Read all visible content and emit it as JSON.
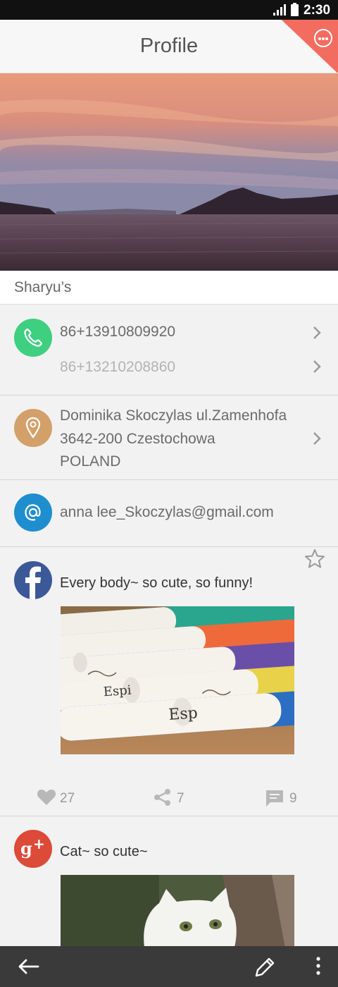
{
  "status_bar": {
    "time": "2:30"
  },
  "header": {
    "title": "Profile"
  },
  "profile": {
    "name": "Sharyu’s"
  },
  "phones": [
    "86+13910809920",
    "86+13210208860"
  ],
  "address": {
    "line1": "Dominika Skoczylas ul.Zamenhofa",
    "line2": "3642-200 Czestochowa",
    "line3": "POLAND"
  },
  "email": "anna lee_Skoczylas@gmail.com",
  "posts": [
    {
      "network": "facebook",
      "text": "Every body~ so cute, so funny!",
      "likes": "27",
      "shares": "7",
      "comments": "9"
    },
    {
      "network": "google-plus",
      "text": "Cat~ so cute~"
    }
  ],
  "colors": {
    "accent_corner": "#f36c60",
    "phone_icon": "#3ecf80",
    "location_icon": "#d3a06a",
    "email_icon": "#1e8ecf",
    "facebook": "#3b5998",
    "google_plus": "#dc4a38",
    "bottom_bar": "#3a3a3a"
  },
  "icons": {
    "status": [
      "signal-icon",
      "battery-icon"
    ],
    "header": "more-options-icon",
    "profile": "star-icon",
    "contact": [
      "phone-icon",
      "location-pin-icon",
      "at-sign-icon"
    ],
    "post_stats": [
      "heart-icon",
      "share-icon",
      "comment-icon"
    ],
    "bottom_bar": [
      "back-arrow-icon",
      "pencil-icon",
      "overflow-menu-icon"
    ]
  }
}
